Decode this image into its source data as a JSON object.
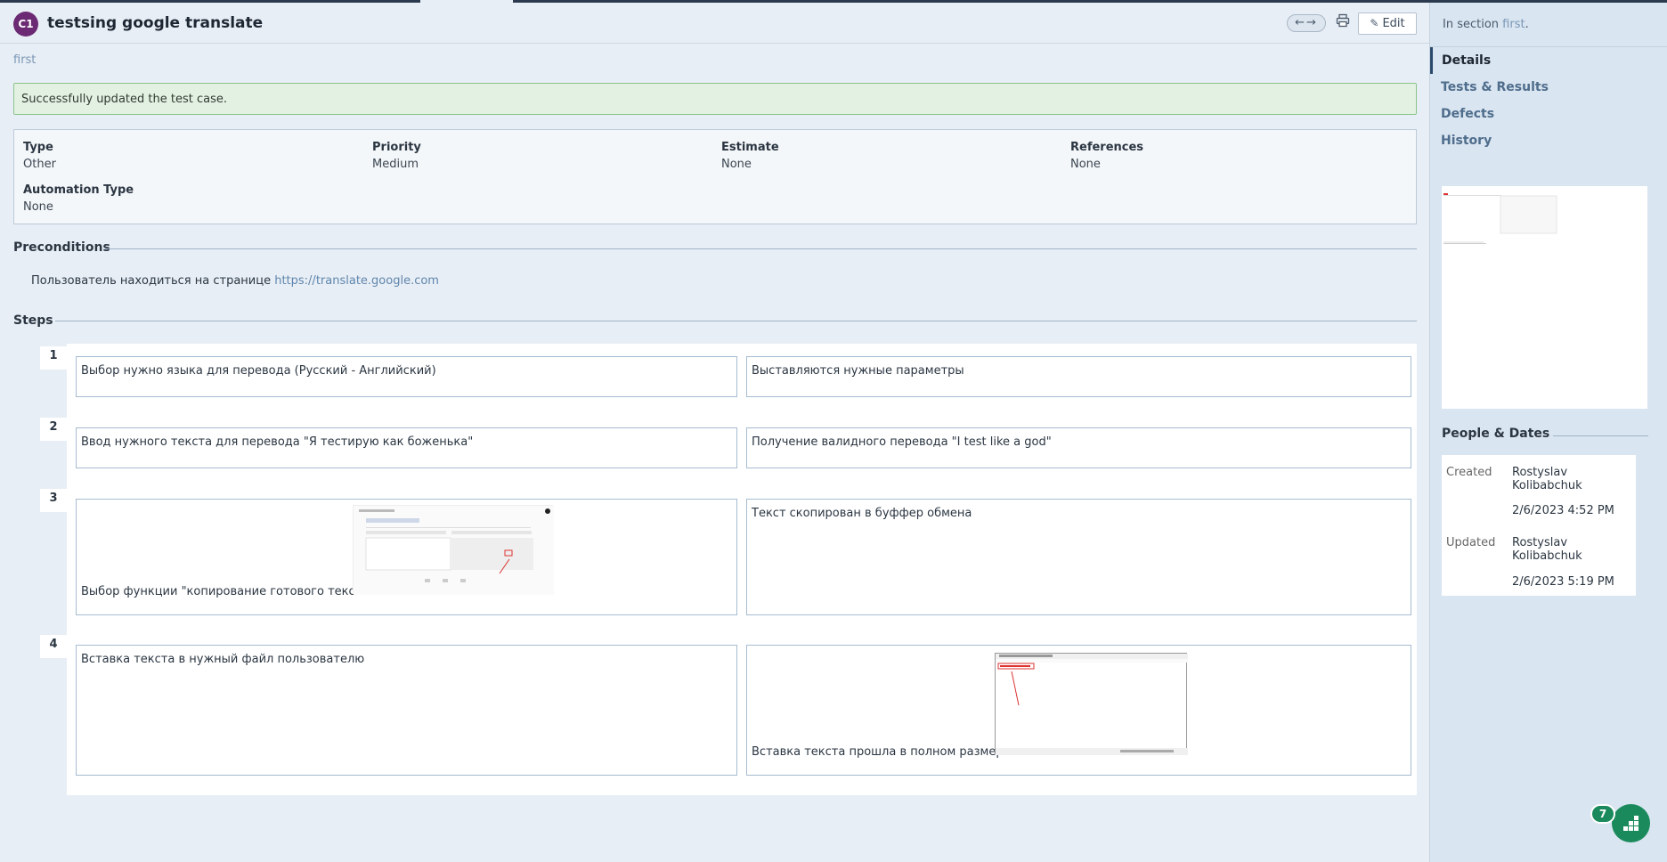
{
  "header": {
    "badge": "C1",
    "title": "testsing google translate",
    "nav_arrows": "←→",
    "edit_label": "Edit"
  },
  "section_link": "first",
  "success_message": "Successfully updated the test case.",
  "properties": {
    "type": {
      "label": "Type",
      "value": "Other"
    },
    "priority": {
      "label": "Priority",
      "value": "Medium"
    },
    "estimate": {
      "label": "Estimate",
      "value": "None"
    },
    "references": {
      "label": "References",
      "value": "None"
    },
    "automation_type": {
      "label": "Automation Type",
      "value": "None"
    }
  },
  "preconditions": {
    "heading": "Preconditions",
    "text": "Пользователь находиться на странице ",
    "link": "https://translate.google.com"
  },
  "steps": {
    "heading": "Steps",
    "items": [
      {
        "num": "1",
        "action": "Выбор нужно языка для перевода (Русский - Английский)",
        "expected": "Выставляются нужные параметры"
      },
      {
        "num": "2",
        "action": "Ввод нужного текста для перевода \"Я тестирую как боженька\"",
        "expected": "Получение валидного перевода \"I test like a god\""
      },
      {
        "num": "3",
        "action": "Выбор функции \"копирование готового текста\"",
        "expected": "Текст скопирован в буффер обмена"
      },
      {
        "num": "4",
        "action": "Вставка текста в нужный файл пользователю",
        "expected": "Вставка текста прошла в полном размере"
      }
    ]
  },
  "sidebar": {
    "in_section_prefix": "In section ",
    "in_section_link": "first",
    "in_section_suffix": ".",
    "tabs": [
      "Details",
      "Tests & Results",
      "Defects",
      "History"
    ],
    "people_dates": {
      "title": "People & Dates",
      "created_label": "Created",
      "created_by_1": "Rostyslav",
      "created_by_2": "Kolibabchuk",
      "created_date": "2/6/2023 4:52 PM",
      "updated_label": "Updated",
      "updated_by_1": "Rostyslav",
      "updated_by_2": "Kolibabchuk",
      "updated_date": "2/6/2023 5:19 PM"
    }
  },
  "help_badge": "7",
  "colors": {
    "accent": "#6b2a73",
    "link": "#5f86ad",
    "success_bg": "#e3f1e3",
    "help_button": "#1a8a5c"
  }
}
